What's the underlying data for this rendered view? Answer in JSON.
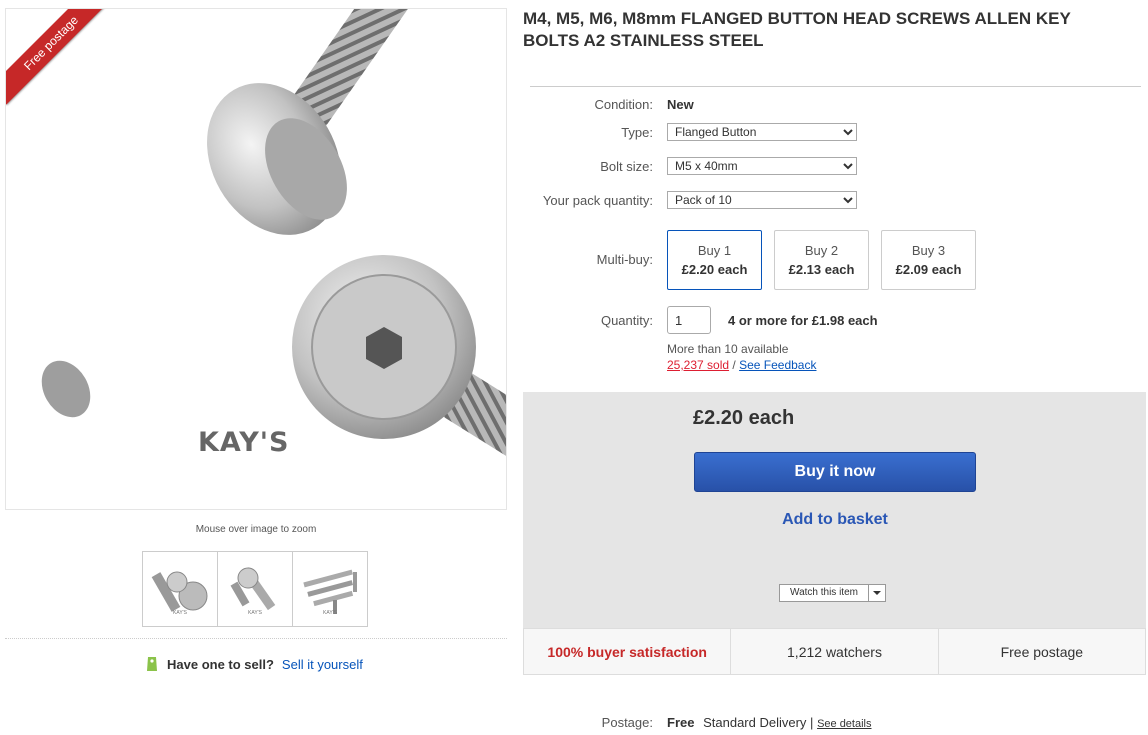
{
  "listing": {
    "title": "M4, M5, M6, M8mm FLANGED BUTTON HEAD SCREWS ALLEN KEY BOLTS A2 STAINLESS STEEL",
    "ribbon": "Free postage",
    "brand_on_image": "KAY'S",
    "zoom_hint": "Mouse over image to zoom",
    "thumbnails": [
      {
        "caption": "KAY'S"
      },
      {
        "caption": "KAY'S"
      },
      {
        "caption": "KAY'S"
      }
    ]
  },
  "sell": {
    "question": "Have one to sell?",
    "link": "Sell it yourself"
  },
  "details": {
    "condition_label": "Condition:",
    "condition_value": "New",
    "type_label": "Type:",
    "type_value": "Flanged Button",
    "bolt_label": "Bolt size:",
    "bolt_value": "M5 x 40mm",
    "pack_label": "Your pack quantity:",
    "pack_value": "Pack of 10"
  },
  "multibuy": {
    "label": "Multi-buy:",
    "options": [
      {
        "qty": "Buy 1",
        "price": "£2.20 each"
      },
      {
        "qty": "Buy 2",
        "price": "£2.13 each"
      },
      {
        "qty": "Buy 3",
        "price": "£2.09 each"
      }
    ]
  },
  "quantity": {
    "label": "Quantity:",
    "value": "1",
    "offer": "4 or more for £1.98 each",
    "available": "More than 10 available",
    "sold": "25,237 sold",
    "separator": "/",
    "feedback": "See Feedback"
  },
  "buybox": {
    "price": "£2.20 each",
    "buy_now": "Buy it now",
    "add_basket": "Add to basket",
    "watch": "Watch this item"
  },
  "stats": {
    "satisfaction": "100% buyer satisfaction",
    "watchers": "1,212 watchers",
    "postage": "Free postage"
  },
  "postage": {
    "label": "Postage:",
    "cost": "Free",
    "service": "Standard Delivery",
    "separator": "|",
    "details_link": "See details"
  },
  "colors": {
    "accent_blue": "#0654ba",
    "buy_button": "#2f5fbd",
    "ribbon_red": "#c62828",
    "sold_red": "#dd1e31"
  }
}
